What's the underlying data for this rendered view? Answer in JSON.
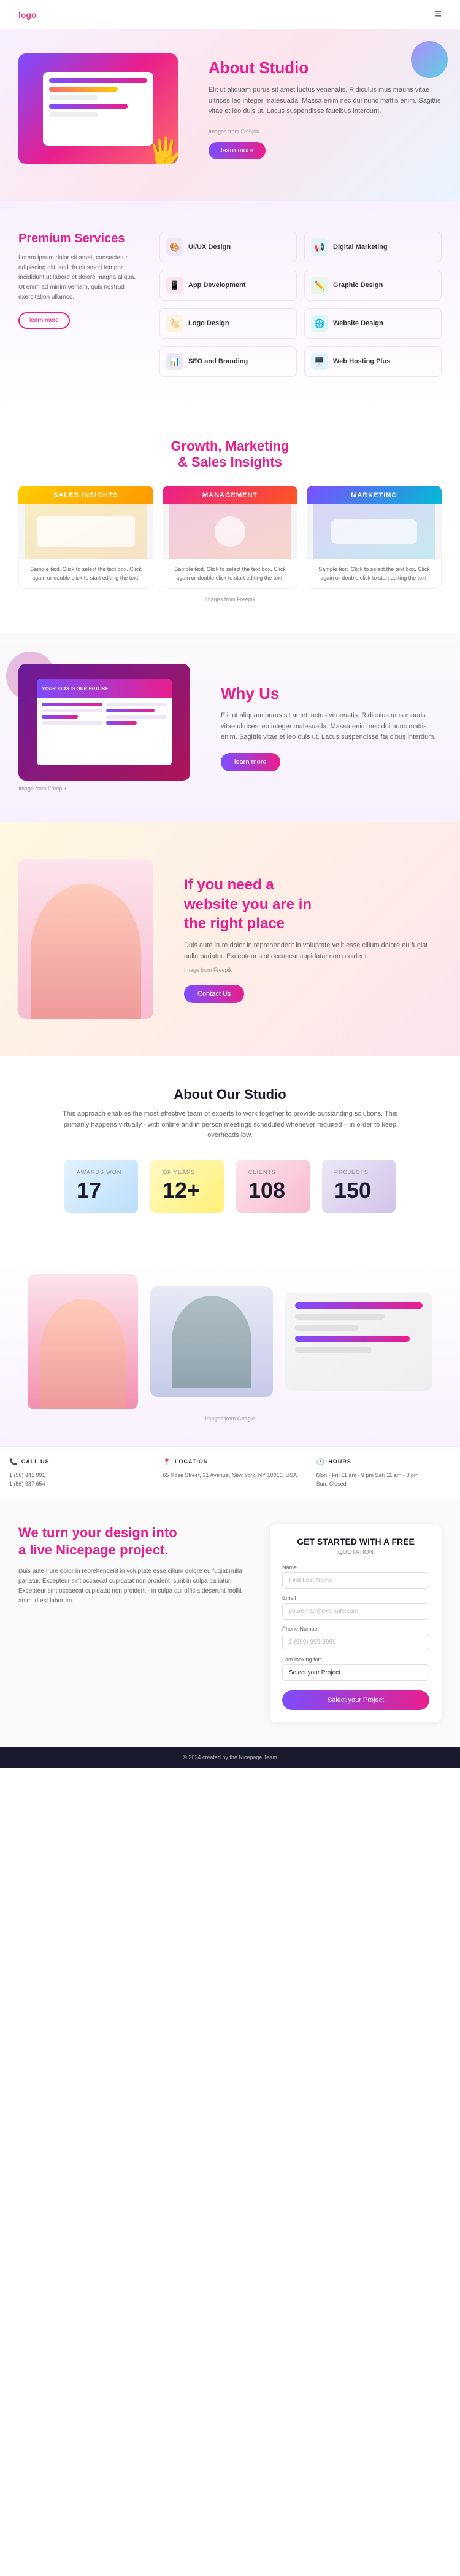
{
  "nav": {
    "logo": "logo",
    "menu_icon": "≡"
  },
  "hero": {
    "title_line1": "About",
    "title_line2": " Studio",
    "body": "Elit ut aliquam purus sit amet luctus venenatis. Ridiculus mus mauris vitae ultrices leo integer malesuada. Massa enim nec dui nunc mattis enim. Sagittis vitae et leo duis ut. Lacus suspendisse faucibus interdum.",
    "images_credit": "Images from Freepik",
    "btn_label": "learn more"
  },
  "premium": {
    "section_title": "Premium Services",
    "body": "Lorem ipsum dolor sit amet, consectetur adipiscing elit, sed do eiusmod tempor incididunt ut labore et dolore magna aliqua. Ut enim ad minim veniam, quis nostrud exercitation ullamco.",
    "btn_label": "learn more",
    "services": [
      {
        "icon": "🎨",
        "label": "UI/UX Design",
        "icon_class": "purple"
      },
      {
        "icon": "📢",
        "label": "Digital Marketing",
        "icon_class": "blue"
      },
      {
        "icon": "📱",
        "label": "App Development",
        "icon_class": "pink"
      },
      {
        "icon": "✏️",
        "label": "Graphic Design",
        "icon_class": "green"
      },
      {
        "icon": "🏷️",
        "label": "Logo Design",
        "icon_class": "orange"
      },
      {
        "icon": "🌐",
        "label": "Website Design",
        "icon_class": "teal"
      },
      {
        "icon": "📊",
        "label": "SEO and Branding",
        "icon_class": "purple"
      },
      {
        "icon": "🖥️",
        "label": "Web Hosting Plus",
        "icon_class": "blue"
      }
    ]
  },
  "growth": {
    "title_line1": "Growth, Marketing",
    "title_line2": "& Sales Insights",
    "cards": [
      {
        "header": "SALES INSIGHTS",
        "header_class": "card-sales",
        "body": "Sample text. Click to select the text box. Click again or double click to start editing the text."
      },
      {
        "header": "MANAGEMENT",
        "header_class": "card-mgmt",
        "body": "Sample text. Click to select the text box. Click again or double click to start editing the text."
      },
      {
        "header": "MARKETING",
        "header_class": "card-mktg",
        "body": "Sample text. Click to select the text box. Click again or double click to start editing the text."
      }
    ],
    "images_credit": "Images from Freepik"
  },
  "whyus": {
    "title": "Why Us",
    "body": "Elit ut aliquam purus sit amet luctus venenatis. Ridiculus mus mauris vitae ultrices leo integer malesuada. Massa enim nec dui nunc mattis enim. Sagittis vitae et leo duis ut. Lacus suspendisse faucibus interdum.",
    "image_credit": "Image from Freepik",
    "btn_label": "learn more",
    "screen_tagline": "YOUR KIDS IS OUR FUTURE"
  },
  "cta": {
    "title_line1": "If you need a",
    "title_line2": "website you are in",
    "title_line3": "the right place",
    "body": "Duis aute irure dolor in reprehenderit in voluptate velit esse cillum dolore eu fugiat nulla pariatur. Excepteur sint occaecat cupidatat non proident.",
    "image_credit": "Image from Freepik",
    "btn_label": "Contact Us"
  },
  "about_studio": {
    "title": "About Our Studio",
    "body": "This approach enables the most effective team of experts to work together to provide outstanding solutions. This primarily happens virtually - with online and in person meetings scheduled whenever required – in order to keep overheads low.",
    "stats": [
      {
        "label": "AWARDS WON",
        "num": "17",
        "bg_class": "blue-bg"
      },
      {
        "label": "OF YEARS",
        "num": "12+",
        "bg_class": "yellow-bg"
      },
      {
        "label": "CLIENTS",
        "num": "108",
        "bg_class": "pink-bg"
      },
      {
        "label": "PROJECTS",
        "num": "150",
        "bg_class": "purple-bg"
      }
    ]
  },
  "team": {
    "images_credit": "Images from Google"
  },
  "contact": {
    "blocks": [
      {
        "icon": "📞",
        "title": "CALL US",
        "lines": [
          "1 (56) 341 991",
          "1 (56) 987 654"
        ]
      },
      {
        "icon": "📍",
        "title": "LOCATION",
        "lines": [
          "65 Rose Street, 31 Avenue, New York, NY 10016, USA"
        ]
      },
      {
        "icon": "🕐",
        "title": "HOURS",
        "lines": [
          "Mon - Fri: 11 am - 9 pm Sat: 11 am - 8 pm",
          "Sun: Closed"
        ]
      }
    ]
  },
  "footer": {
    "left_title_line1": "We turn your design into",
    "left_title_line2": "a live Nicepage project.",
    "left_body": "Duis aute irure dolor in reprehenderit in voluptate esse cillum dolore eu fugiat nulla pariatur. Excepteur sint occaecat cupidatat non proident, sunt in culpa pariatur. Excepteur sint occaecat cupidatat non proident - in culpa qui officia deserunt mollit anim id est laborum.",
    "form": {
      "title": "GET STARTED WITH A FREE",
      "subtitle": "QUOTATION",
      "fields": [
        {
          "label": "Name",
          "placeholder": "First Last Name",
          "type": "text"
        },
        {
          "label": "Email",
          "placeholder": "youremail@example.com",
          "type": "email"
        },
        {
          "label": "Phone Number",
          "placeholder": "1 (999) 999-9999",
          "type": "tel"
        }
      ],
      "select_label": "I am looking for:",
      "select_placeholder": "Select your Project",
      "btn_label": "Select your Project"
    }
  },
  "footer_bottom": {
    "text": "© 2024 created by the Nicepage Team"
  }
}
